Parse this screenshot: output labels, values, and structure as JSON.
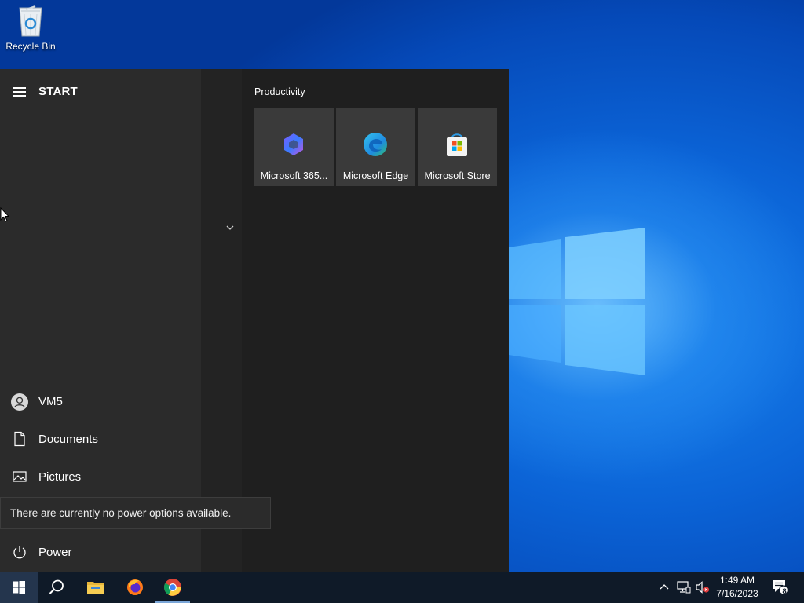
{
  "desktop": {
    "icons": [
      {
        "label": "Recycle Bin",
        "icon": "recycle-bin-icon"
      }
    ]
  },
  "start_menu": {
    "title": "START",
    "user": "VM5",
    "nav": {
      "documents": "Documents",
      "pictures": "Pictures",
      "power": "Power"
    },
    "group_title": "Productivity",
    "tiles": [
      {
        "label": "Microsoft 365...",
        "icon": "microsoft-365-icon"
      },
      {
        "label": "Microsoft Edge",
        "icon": "edge-icon"
      },
      {
        "label": "Microsoft Store",
        "icon": "store-icon"
      }
    ],
    "tooltip": "There are currently no power options available."
  },
  "taskbar": {
    "apps": [
      "start",
      "search",
      "file-explorer",
      "firefox",
      "chrome"
    ],
    "clock": {
      "time": "1:49 AM",
      "date": "7/16/2023"
    },
    "notification_count": "8"
  },
  "colors": {
    "accent": "#0a5fd4",
    "start_left": "#2b2b2b",
    "start_right": "#1f1f1f",
    "tile": "#3a3a3a",
    "taskbar": "#0f1a28"
  }
}
